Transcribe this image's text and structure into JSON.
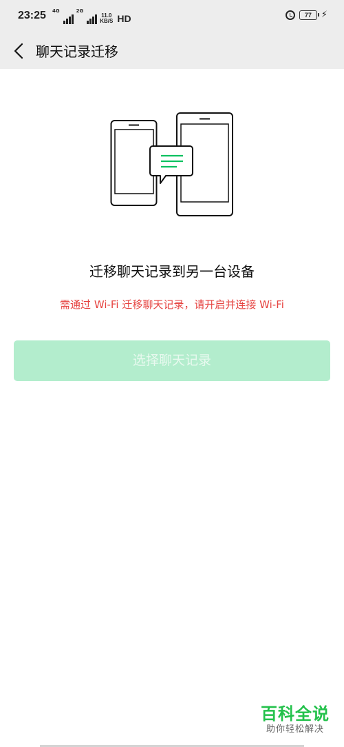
{
  "status_bar": {
    "time": "23:25",
    "net_type_1": "4G",
    "net_type_2": "2G",
    "speed_value": "11.0",
    "speed_unit": "KB/S",
    "hd_label": "HD",
    "battery_level": "77",
    "icons": [
      "signal-icon",
      "signal-icon",
      "alarm-icon",
      "battery-icon",
      "charging-icon"
    ]
  },
  "nav": {
    "back_icon": "chevron-left-icon",
    "title": "聊天记录迁移"
  },
  "main": {
    "illustration_icons": [
      "phone-icon",
      "tablet-icon",
      "chat-bubble-icon"
    ],
    "headline": "迁移聊天记录到另一台设备",
    "notice": "需通过 Wi-Fi 迁移聊天记录，请开启并连接 Wi-Fi",
    "select_button_label": "选择聊天记录"
  },
  "watermark": {
    "title": "百科全说",
    "subtitle": "助你轻松解决"
  },
  "colors": {
    "accent_green": "#07c160",
    "disabled_button": "#b3edcd",
    "warning_red": "#e64340",
    "header_bg": "#ededed",
    "watermark_green": "#23c14b"
  }
}
